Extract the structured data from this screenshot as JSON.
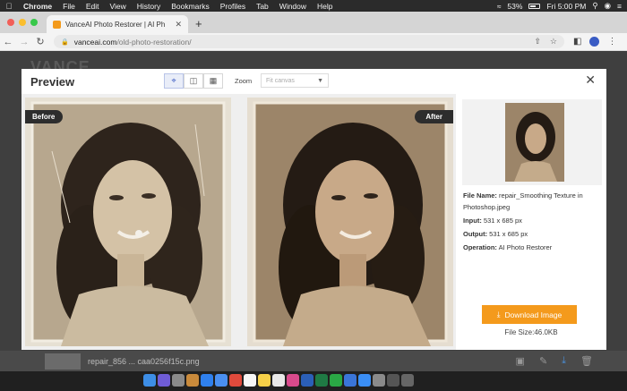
{
  "menubar": {
    "app": "Chrome",
    "items": [
      "File",
      "Edit",
      "View",
      "History",
      "Bookmarks",
      "Profiles",
      "Tab",
      "Window",
      "Help"
    ],
    "battery": "53%",
    "clock": "Fri 5:00 PM"
  },
  "browser": {
    "tab_title": "VanceAI Photo Restorer | AI Ph",
    "url_host": "vanceai.com",
    "url_path": "/old-photo-restoration/",
    "new_tab_symbol": "+"
  },
  "page": {
    "logo": "VANCE"
  },
  "modal": {
    "title": "Preview",
    "zoom_label": "Zoom",
    "zoom_placeholder": "Fit canvas",
    "before_label": "Before",
    "after_label": "After",
    "file_name_label": "File Name:",
    "file_name": "repair_Smoothing Texture in Photoshop.jpeg",
    "input_label": "Input:",
    "input_value": "531 x 685 px",
    "output_label": "Output:",
    "output_value": "531 x 685 px",
    "operation_label": "Operation:",
    "operation_value": "AI Photo Restorer",
    "download_label": "Download Image",
    "file_size": "File Size:46.0KB"
  },
  "bottom_bar": {
    "file_name": "repair_856 ... caa0256f15c.png"
  },
  "colors": {
    "accent_orange": "#f49a1c",
    "label_dark": "#2d2d2d",
    "selected_view": "#3a5cc4"
  }
}
